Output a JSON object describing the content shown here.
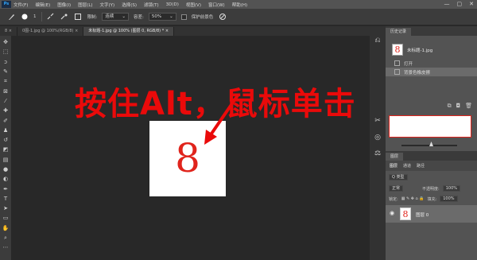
{
  "app": {
    "logo_text": "Ps",
    "menu": [
      "文件(F)",
      "编辑(E)",
      "图像(I)",
      "图层(L)",
      "文字(Y)",
      "选择(S)",
      "滤镜(T)",
      "3D(D)",
      "视图(V)",
      "窗口(W)",
      "帮助(H)"
    ],
    "window_controls": [
      "—",
      "▢",
      "✕"
    ]
  },
  "options_bar": {
    "brush_size": "1",
    "mode_label": "限制:",
    "mode_value": "连续",
    "tolerance_label": "容差:",
    "tolerance_value": "50%",
    "checkbox_label": "保护前景色"
  },
  "tabs": [
    {
      "label": "8 ×",
      "active": false
    },
    {
      "label": "0图-1.jpg @ 100%(RGB/8) ×",
      "active": false
    },
    {
      "label": "未标题-1.jpg @ 100% (图层 0, RGB/8) * ×",
      "active": true
    }
  ],
  "canvas": {
    "digit": "8",
    "annotation": "按住Alt，鼠标单击"
  },
  "history_panel": {
    "title": "历史记录",
    "snapshot_label": "未标题-1.jpg",
    "snapshot_digit": "8",
    "items": [
      {
        "label": "打开",
        "selected": false
      },
      {
        "label": "背景色橡皮擦",
        "selected": true
      }
    ]
  },
  "layers_panel": {
    "title": "图层",
    "subtabs": [
      "图层",
      "通道",
      "路径"
    ],
    "filter_label": "Q 类型",
    "blend_mode": "正常",
    "opacity_label": "不透明度:",
    "opacity_value": "100%",
    "lock_label": "锁定:",
    "fill_label": "填充:",
    "fill_value": "100%",
    "layer_name": "图层 0",
    "layer_digit": "8"
  },
  "colors": {
    "accent_red": "#e0241c",
    "annotation_red": "#ea0a0a",
    "workspace": "#282828",
    "panel": "#535353"
  }
}
